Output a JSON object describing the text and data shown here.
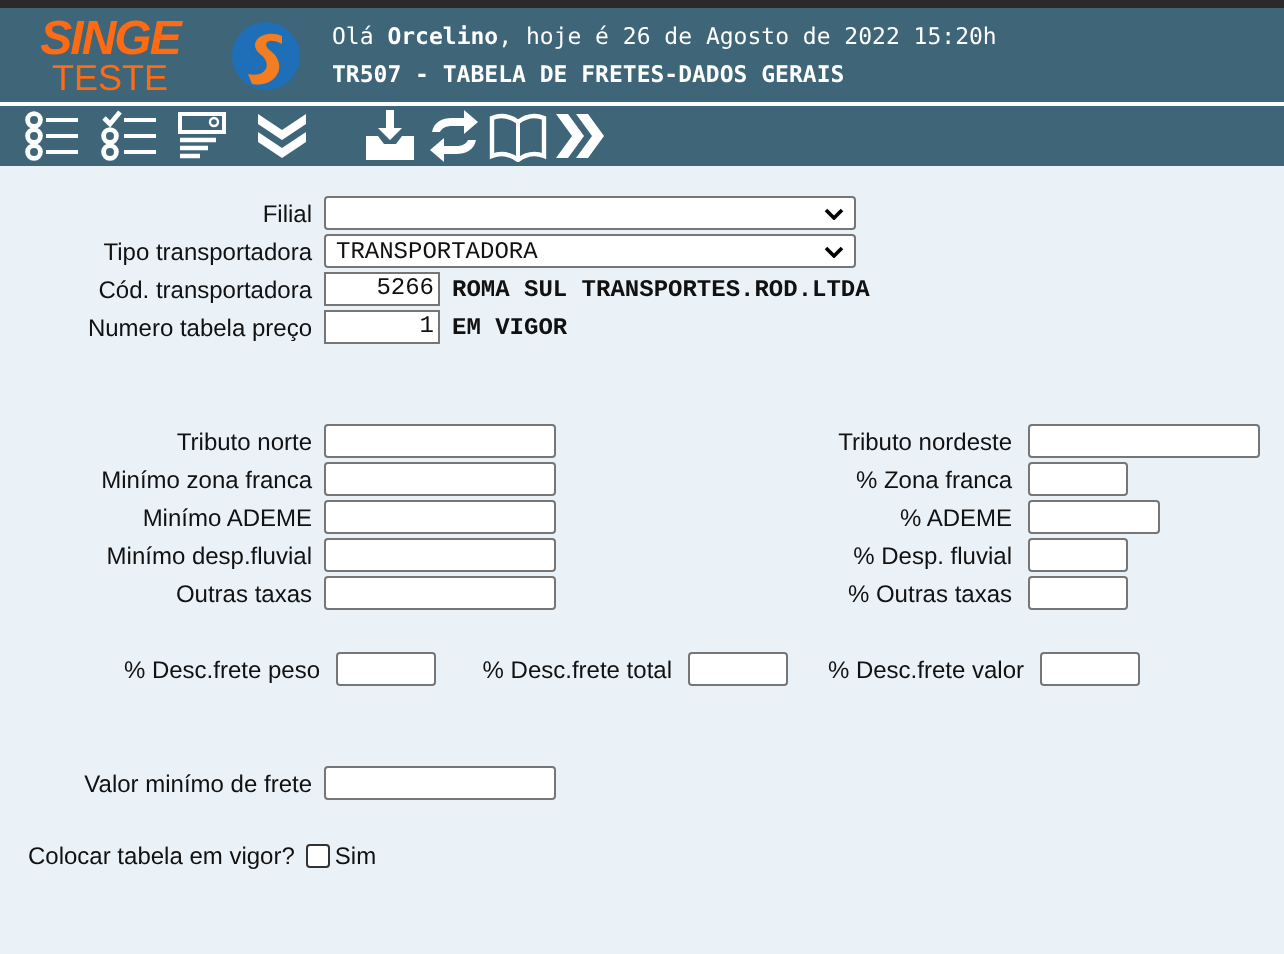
{
  "header": {
    "logo_top": "SINGE",
    "logo_bottom": "TESTE",
    "greeting": "Olá **Orcelino**, hoje é 26 de Agosto de 2022 15:20h",
    "title": "TR507 - TABELA DE FRETES-DADOS GERAIS"
  },
  "top_fields": [
    {
      "kind": "select",
      "label": "Filial"
    },
    {
      "kind": "select",
      "label": "Tipo transportadora",
      "value": "TRANSPORTADORA"
    },
    {
      "kind": "code",
      "label": "Cód. transportadora",
      "value": "5266",
      "description": "ROMA SUL TRANSPORTES.ROD.LTDA"
    },
    {
      "kind": "code",
      "label": "Numero tabela preço",
      "value": "1",
      "description": "EM VIGOR"
    }
  ],
  "tax_rows": [
    {
      "left": "Tributo norte",
      "right": "Tributo nordeste"
    },
    {
      "left": "Minímo zona franca",
      "right": "% Zona franca"
    },
    {
      "left": "Minímo ADEME",
      "right": "% ADEME"
    },
    {
      "left": "Minímo desp.fluvial",
      "right": "% Desp. fluvial"
    },
    {
      "left": "Outras taxas",
      "right": "% Outras taxas"
    }
  ],
  "discounts": [
    "% Desc.frete peso",
    "% Desc.frete total",
    "% Desc.frete valor"
  ],
  "min_freight": {
    "label": "Valor minímo de frete"
  },
  "activate": {
    "label": "Colocar tabela em vigor?",
    "option": "Sim",
    "checked": false
  }
}
